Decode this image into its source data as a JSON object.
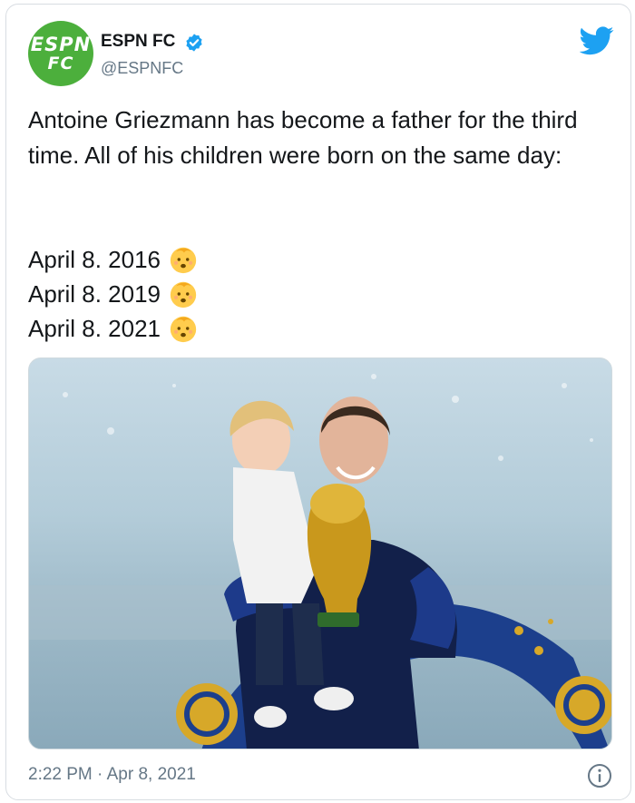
{
  "account": {
    "name": "ESPN FC",
    "handle": "@ESPNFC",
    "avatar_text_top": "ESPN",
    "avatar_text_bottom": "FC"
  },
  "tweet": {
    "text": "Antoine Griezmann has become a father for the third time. All of his children were born on the same day:",
    "dates": [
      "April 8. 2016",
      "April 8. 2019",
      "April 8. 2021"
    ],
    "emoji": "baby-face-icon"
  },
  "footer": {
    "timestamp": "2:22 PM · Apr 8, 2021"
  },
  "colors": {
    "accent": "#1da1f2",
    "avatar_bg": "#4caf3c",
    "muted_text": "#657786"
  }
}
